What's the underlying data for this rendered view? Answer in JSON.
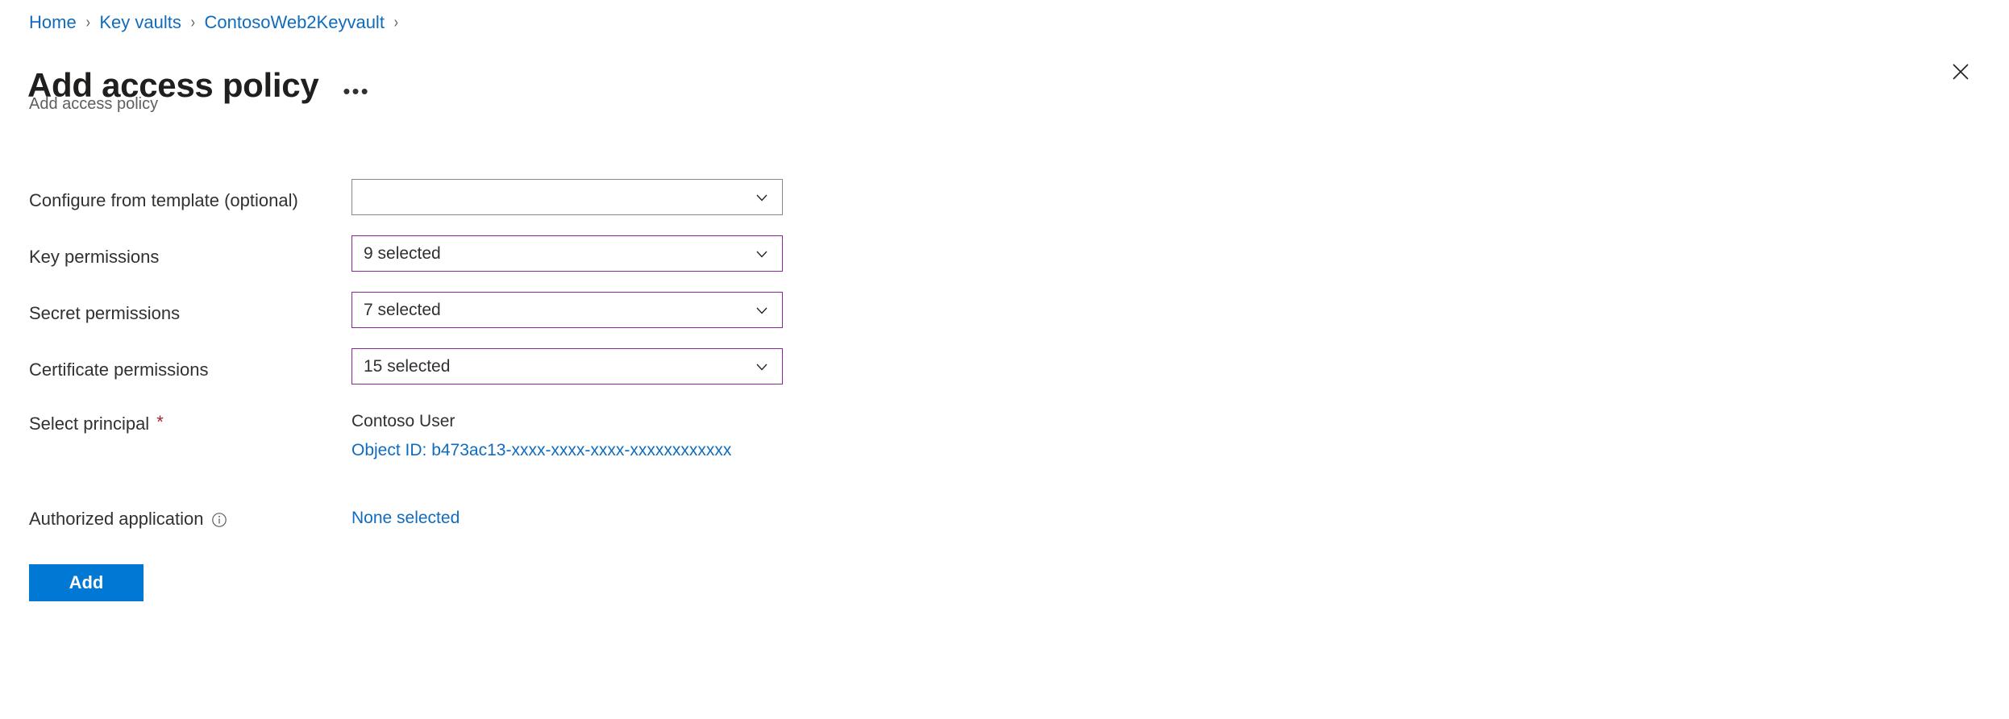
{
  "breadcrumb": {
    "items": [
      {
        "label": "Home"
      },
      {
        "label": "Key vaults"
      },
      {
        "label": "ContosoWeb2Keyvault"
      }
    ],
    "separator": "›",
    "link_color": "#0f6cbd"
  },
  "header": {
    "title": "Add access policy",
    "subtitle": "Add access policy",
    "more_label": "•••",
    "close_label": "Close",
    "more_icon": "ellipsis-icon",
    "close_icon": "close-icon"
  },
  "form": {
    "rows": [
      {
        "label": "Configure from template (optional)",
        "control": "dropdown",
        "value": "",
        "placeholder": "",
        "accent": false,
        "name": "configure-from-template"
      },
      {
        "label": "Key permissions",
        "control": "dropdown",
        "value": "9 selected",
        "accent": true,
        "name": "key-permissions"
      },
      {
        "label": "Secret permissions",
        "control": "dropdown",
        "value": "7 selected",
        "accent": true,
        "name": "secret-permissions"
      },
      {
        "label": "Certificate permissions",
        "control": "dropdown",
        "value": "15 selected",
        "accent": true,
        "name": "certificate-permissions"
      }
    ],
    "select_principal": {
      "label": "Select principal",
      "required_marker": "*",
      "principal_name": "Contoso User",
      "principal_object_id": "Object ID: b473ac13-xxxx-xxxx-xxxx-xxxxxxxxxxxx"
    },
    "authorized_application": {
      "label": "Authorized application",
      "info_icon": "info-icon",
      "value": "None selected"
    },
    "submit": {
      "label": "Add"
    }
  },
  "colors": {
    "accent_blue": "#0078d4",
    "link_blue": "#0f6cbd",
    "dropdown_accent_purple": "#8c259a",
    "required_red": "#a4262c",
    "text_primary": "#323130",
    "text_secondary": "#605e5c"
  }
}
